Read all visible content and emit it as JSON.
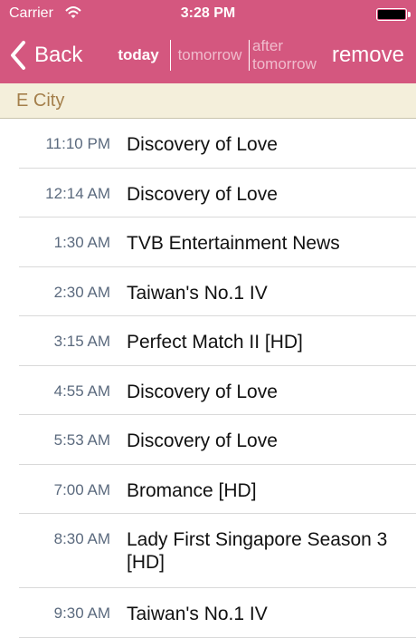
{
  "status_bar": {
    "carrier": "Carrier",
    "time": "3:28 PM"
  },
  "nav": {
    "back_label": "Back",
    "tabs": [
      "today",
      "tomorrow",
      "after tomorrow"
    ],
    "remove_label": "remove"
  },
  "section": {
    "title": "E City"
  },
  "programs": [
    {
      "time": "11:10 PM",
      "title": "Discovery of Love"
    },
    {
      "time": "12:14 AM",
      "title": "Discovery of Love"
    },
    {
      "time": "1:30 AM",
      "title": "TVB Entertainment News"
    },
    {
      "time": "2:30 AM",
      "title": "Taiwan's No.1 IV"
    },
    {
      "time": "3:15 AM",
      "title": "Perfect Match II [HD]"
    },
    {
      "time": "4:55 AM",
      "title": "Discovery of Love"
    },
    {
      "time": "5:53 AM",
      "title": "Discovery of Love"
    },
    {
      "time": "7:00 AM",
      "title": "Bromance [HD]"
    },
    {
      "time": "8:30 AM",
      "title": "Lady First Singapore Season 3 [HD]"
    },
    {
      "time": "9:30 AM",
      "title": "Taiwan's No.1 IV"
    }
  ],
  "colors": {
    "nav_background": "#d4577f",
    "section_background": "#f4efdb",
    "section_text": "#a47f4b",
    "time_text": "#5b6a7e"
  }
}
